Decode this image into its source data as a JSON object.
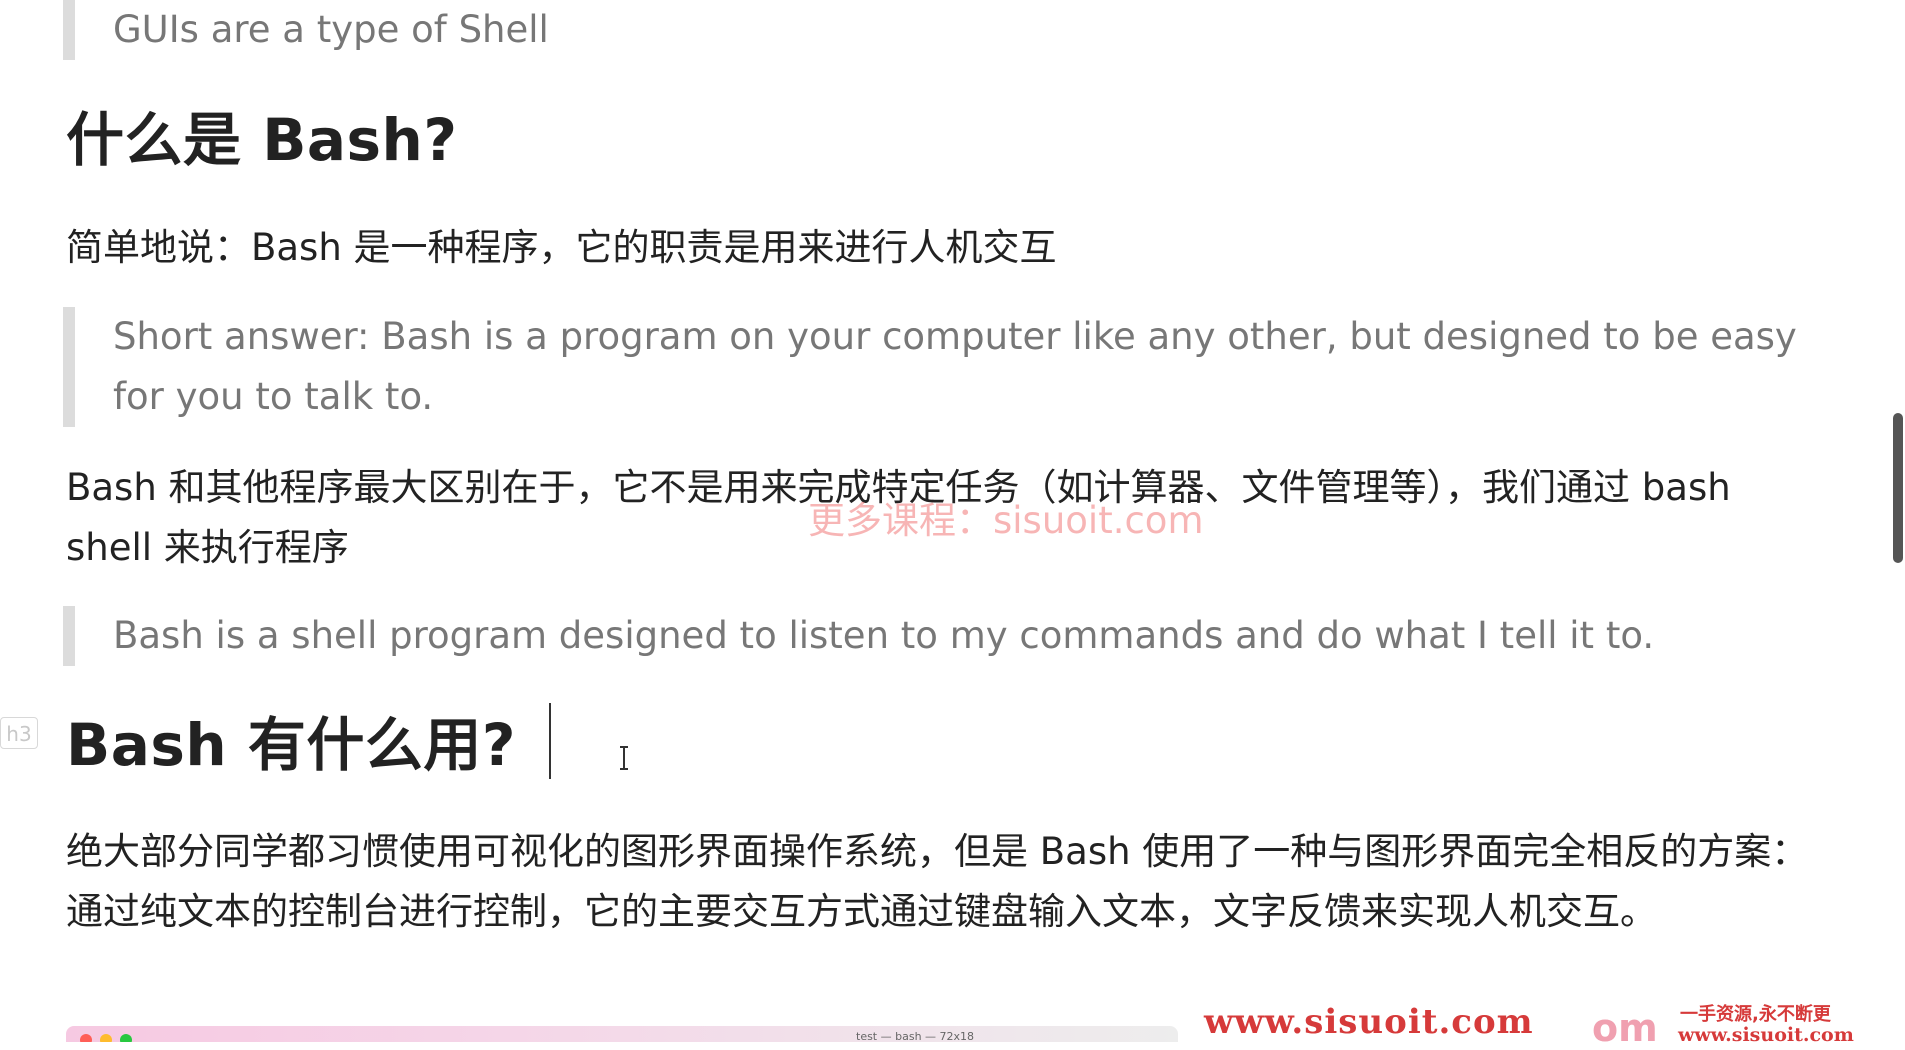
{
  "quote_top": "GUIs are a type of Shell",
  "heading_what_is_bash": "什么是 Bash?",
  "para_short": "简单地说：Bash 是一种程序，它的职责是用来进行人机交互",
  "quote_short_answer": "Short answer: Bash is a program on your computer like any other, but designed to be easy for you to talk to.",
  "para_difference": "Bash 和其他程序最大区别在于，它不是用来完成特定任务（如计算器、文件管理等），我们通过 bash shell 来执行程序",
  "quote_listen": "Bash is a shell program designed to listen to my commands and do what I tell it to.",
  "heading_uses_badge": "h3",
  "heading_uses": "Bash 有什么用?",
  "para_uses": "绝大部分同学都习惯使用可视化的图形界面操作系统，但是 Bash 使用了一种与图形界面完全相反的方案：通过纯文本的控制台进行控制，它的主要交互方式通过键盘输入文本，文字反馈来实现人机交互。",
  "watermark_center": "更多课程：sisuoit.com",
  "embedded_window_title": "test — bash — 72x18",
  "watermark_site": "www.sisuoit.com",
  "watermark_om": "om",
  "watermark_slogan": "一手资源,永不断更",
  "watermark_site_small": "www.sisuoit.com",
  "colors": {
    "quote_bar": "#dcdcdc",
    "quote_text": "#777777",
    "body_text": "#222222",
    "watermark_red": "#d63a3a"
  }
}
